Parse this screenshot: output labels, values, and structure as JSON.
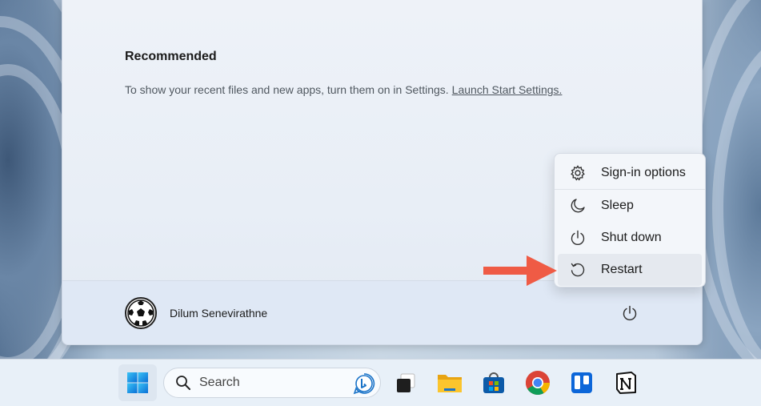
{
  "start_menu": {
    "recommended": {
      "title": "Recommended",
      "message": "To show your recent files and new apps, turn them on in Settings.",
      "link_text": "Launch Start Settings."
    },
    "user": {
      "name": "Dilum Senevirathne",
      "avatar_icon": "soccer-ball-avatar"
    },
    "power_button_icon": "power-icon"
  },
  "power_menu": {
    "items": [
      {
        "label": "Sign-in options",
        "icon": "gear-icon"
      },
      {
        "label": "Sleep",
        "icon": "moon-icon"
      },
      {
        "label": "Shut down",
        "icon": "power-icon"
      },
      {
        "label": "Restart",
        "icon": "restart-icon",
        "highlighted": true
      }
    ]
  },
  "annotation": {
    "icon": "red-arrow",
    "color": "#ef5b45"
  },
  "taskbar": {
    "search_placeholder": "Search",
    "apps": [
      "start-icon",
      "task-view-icon",
      "file-explorer-icon",
      "microsoft-store-icon",
      "chrome-icon",
      "trello-icon",
      "notion-icon"
    ]
  }
}
